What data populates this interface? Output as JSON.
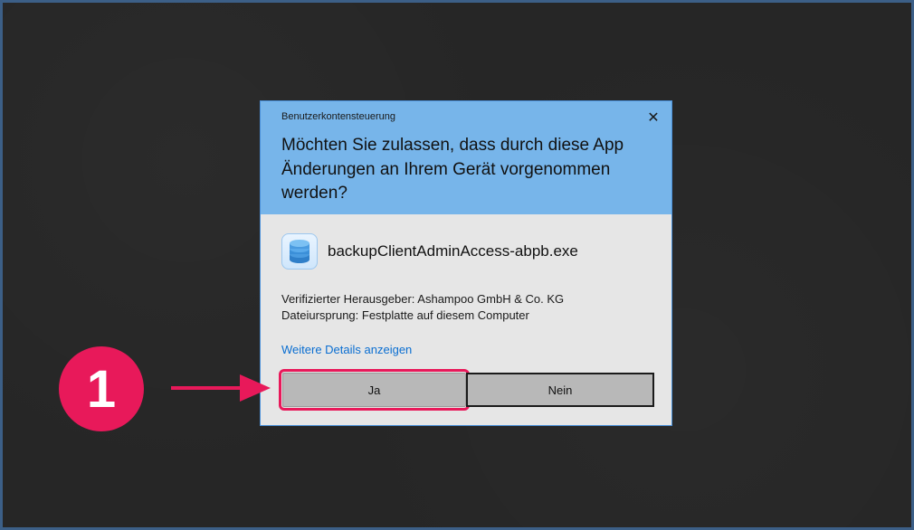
{
  "dialog": {
    "caption": "Benutzerkontensteuerung",
    "close_glyph": "✕",
    "question": "Möchten Sie zulassen, dass durch diese App Änderungen an Ihrem Gerät vorgenommen werden?",
    "app_icon": "database-stack-icon",
    "app_name": "backupClientAdminAccess-abpb.exe",
    "publisher": "Verifizierter Herausgeber: Ashampoo GmbH & Co. KG",
    "origin": "Dateiursprung: Festplatte auf diesem Computer",
    "details_link": "Weitere Details anzeigen",
    "yes_label": "Ja",
    "no_label": "Nein"
  },
  "annotation": {
    "step_number": "1",
    "highlight_color": "#e8195a"
  },
  "colors": {
    "header_bg": "#77b5ea",
    "dialog_bg": "#e6e6e6",
    "link": "#0a6ed1",
    "background": "#262626"
  }
}
